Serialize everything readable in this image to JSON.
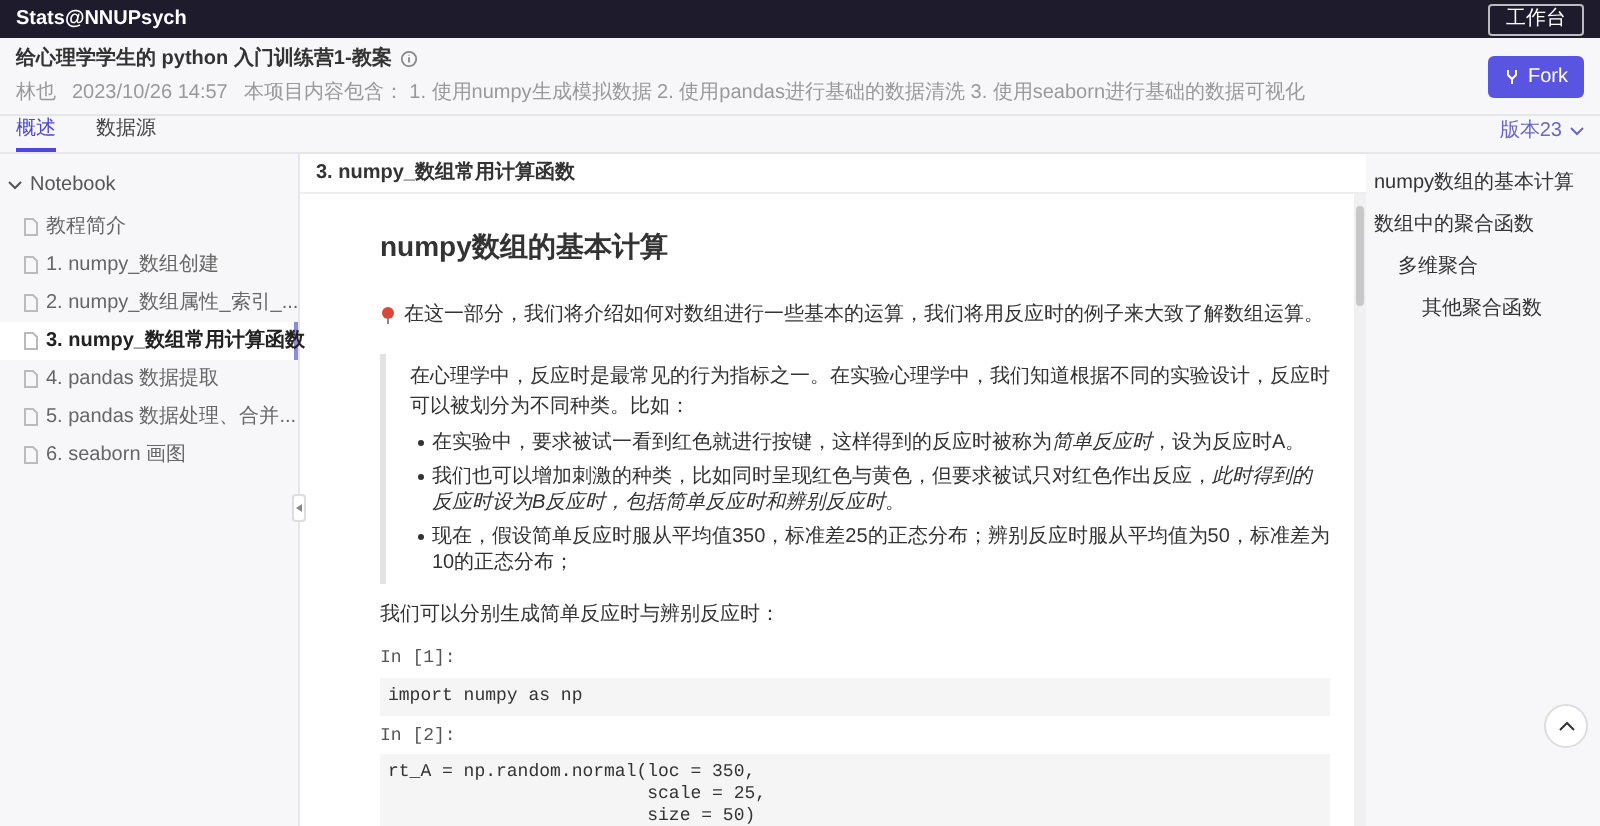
{
  "topbar": {
    "brand": "Stats@NNUPsych",
    "workspace_button": "工作台"
  },
  "header": {
    "title": "给心理学学生的 python 入门训练营1-教案",
    "author": "林也",
    "date": "2023/10/26 14:57",
    "description": "本项目内容包含： 1. 使用numpy生成模拟数据 2. 使用pandas进行基础的数据清洗 3. 使用seaborn进行基础的数据可视化",
    "fork_button": "Fork"
  },
  "tabs": [
    {
      "label": "概述",
      "selected": true
    },
    {
      "label": "数据源",
      "selected": false
    }
  ],
  "version": "版本23",
  "sidebar": {
    "root": {
      "label": "Notebook",
      "expanded": true,
      "children": [
        {
          "label": "教程简介",
          "selected": false
        },
        {
          "label": "1. numpy_数组创建",
          "selected": false
        },
        {
          "label": "2. numpy_数组属性_索引_...",
          "selected": false
        },
        {
          "label": "3. numpy_数组常用计算函数",
          "selected": true
        },
        {
          "label": "4. pandas 数据提取",
          "selected": false
        },
        {
          "label": "5. pandas 数据处理、合并...",
          "selected": false
        },
        {
          "label": "6. seaborn 画图",
          "selected": false
        }
      ]
    }
  },
  "main": {
    "notebook_title": "3. numpy_数组常用计算函数",
    "heading": "numpy数组的基本计算",
    "intro": "在这一部分，我们将介绍如何对数组进行一些基本的运算，我们将用反应时的例子来大致了解数组运算。",
    "quote": {
      "paragraph": "在心理学中，反应时是最常见的行为指标之一。在实验心理学中，我们知道根据不同的实验设计，反应时可以被划分为不同种类。比如：",
      "bullets": [
        [
          {
            "text": "在实验中，要求被试一看到红色就进行按键，这样得到的反应时被称为",
            "italic": false
          },
          {
            "text": "简单反应时",
            "italic": true
          },
          {
            "text": "，设为反应时A。",
            "italic": false
          }
        ],
        [
          {
            "text": "我们也可以增加刺激的种类，比如同时呈现红色与黄色，但要求被试只对红色作出反应，",
            "italic": false
          },
          {
            "text": "此时得到的反应时设为B反应时，包括简单反应时和辨别反应时",
            "italic": true
          },
          {
            "text": "。",
            "italic": false
          }
        ],
        [
          {
            "text": "现在，假设简单反应时服从平均值350，标准差25的正态分布；辨别反应时服从平均值为50，标准差为10的正态分布；",
            "italic": false
          }
        ]
      ]
    },
    "after": "我们可以分别生成简单反应时与辨别反应时：",
    "cells": [
      {
        "prompt": "In [1]:",
        "lines": [
          "import numpy as np"
        ]
      },
      {
        "prompt": "In [2]:",
        "lines": [
          "rt_A = np.random.normal(loc = 350,",
          "                        scale = 25,",
          "                        size = 50)"
        ]
      }
    ]
  },
  "toc": [
    {
      "label": "numpy数组的基本计算"
    },
    {
      "label": "数组中的聚合函数",
      "children": [
        {
          "label": "多维聚合",
          "children": [
            {
              "label": "其他聚合函数"
            }
          ]
        }
      ]
    }
  ]
}
